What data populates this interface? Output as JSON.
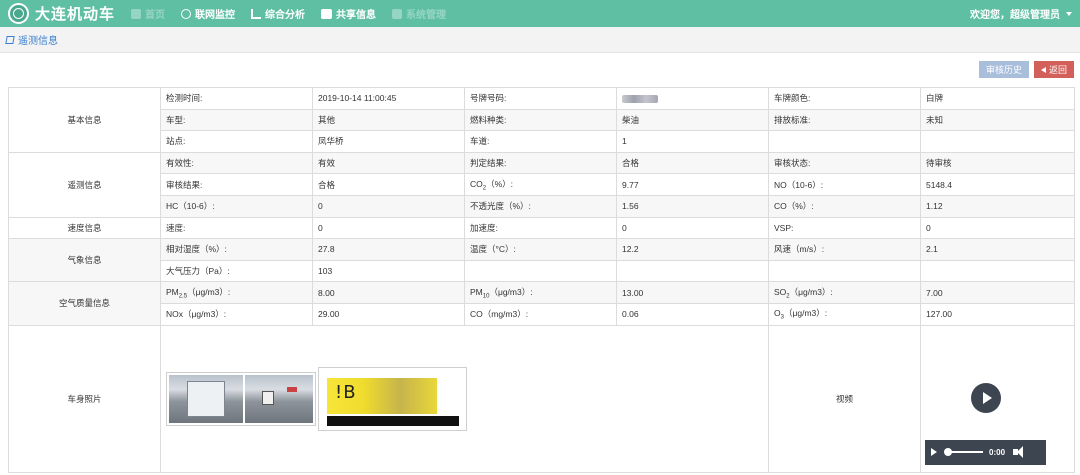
{
  "header": {
    "app_title": "大连机动车",
    "nav": [
      {
        "label": "首页",
        "icon": "home-icon",
        "faded": true
      },
      {
        "label": "联网监控",
        "icon": "monitor-icon",
        "faded": false
      },
      {
        "label": "综合分析",
        "icon": "chart-icon",
        "faded": false
      },
      {
        "label": "共享信息",
        "icon": "share-icon",
        "faded": false
      },
      {
        "label": "系统管理",
        "icon": "settings-icon",
        "faded": true
      }
    ],
    "user_greeting": "欢迎您，超级管理员"
  },
  "breadcrumb": {
    "label": "遥测信息"
  },
  "actions": {
    "history_label": "审核历史",
    "back_label": "返回"
  },
  "basic": {
    "group": "基本信息",
    "detect_time_label": "检测时间:",
    "detect_time": "2019-10-14 11:00:45",
    "plate_label": "号牌号码:",
    "plate_color_label": "车牌颜色:",
    "plate_color": "白牌",
    "vehicle_type_label": "车型:",
    "vehicle_type": "其他",
    "fuel_label": "燃料种类:",
    "fuel": "柴油",
    "emission_std_label": "排放标准:",
    "emission_std": "未知",
    "station_label": "站点:",
    "station": "凤华桥",
    "lane_label": "车道:",
    "lane": "1"
  },
  "telemetry": {
    "group": "遥测信息",
    "valid_label": "有效性:",
    "valid": "有效",
    "judgement_label": "判定结果:",
    "judgement": "合格",
    "review_status_label": "审核状态:",
    "review_status": "待审核",
    "review_result_label": "审核结果:",
    "review_result": "合格",
    "co2_label_pre": "CO",
    "co2_sub": "2",
    "co2_label_post": "（%）:",
    "co2": "9.77",
    "no_label": "NO（10-6）:",
    "no": "5148.4",
    "hc_label": "HC（10-6）:",
    "hc": "0",
    "opacity_label": "不透光度（%）:",
    "opacity": "1.56",
    "co_label": "CO（%）:",
    "co": "1.12"
  },
  "speed": {
    "group": "速度信息",
    "speed_label": "速度:",
    "speed": "0",
    "accel_label": "加速度:",
    "accel": "0",
    "vsp_label": "VSP:",
    "vsp": "0"
  },
  "weather": {
    "group": "气象信息",
    "humidity_label": "相对湿度（%）:",
    "humidity": "27.8",
    "temp_label": "温度（°C）:",
    "temp": "12.2",
    "wind_label": "风速（m/s）:",
    "wind": "2.1",
    "pressure_label": "大气压力（Pa）:",
    "pressure": "103"
  },
  "air": {
    "group": "空气质量信息",
    "pm25_pre": "PM",
    "pm25_sub": "2.5",
    "pm25_post": "（μg/m3）:",
    "pm25": "8.00",
    "pm10_pre": "PM",
    "pm10_sub": "10",
    "pm10_post": "（μg/m3）:",
    "pm10": "13.00",
    "so2_pre": "SO",
    "so2_sub": "2",
    "so2_post": "（μg/m3）:",
    "so2": "7.00",
    "nox_label": "NOx（μg/m3）:",
    "nox": "29.00",
    "co_label": "CO（mg/m3）:",
    "co": "0.06",
    "o3_pre": "O",
    "o3_sub": "3",
    "o3_post": "（μg/m3）:",
    "o3": "127.00"
  },
  "media": {
    "group": "车身照片",
    "plate_photo_text": "!B",
    "video_label": "视频",
    "audio_time": "0:00"
  }
}
